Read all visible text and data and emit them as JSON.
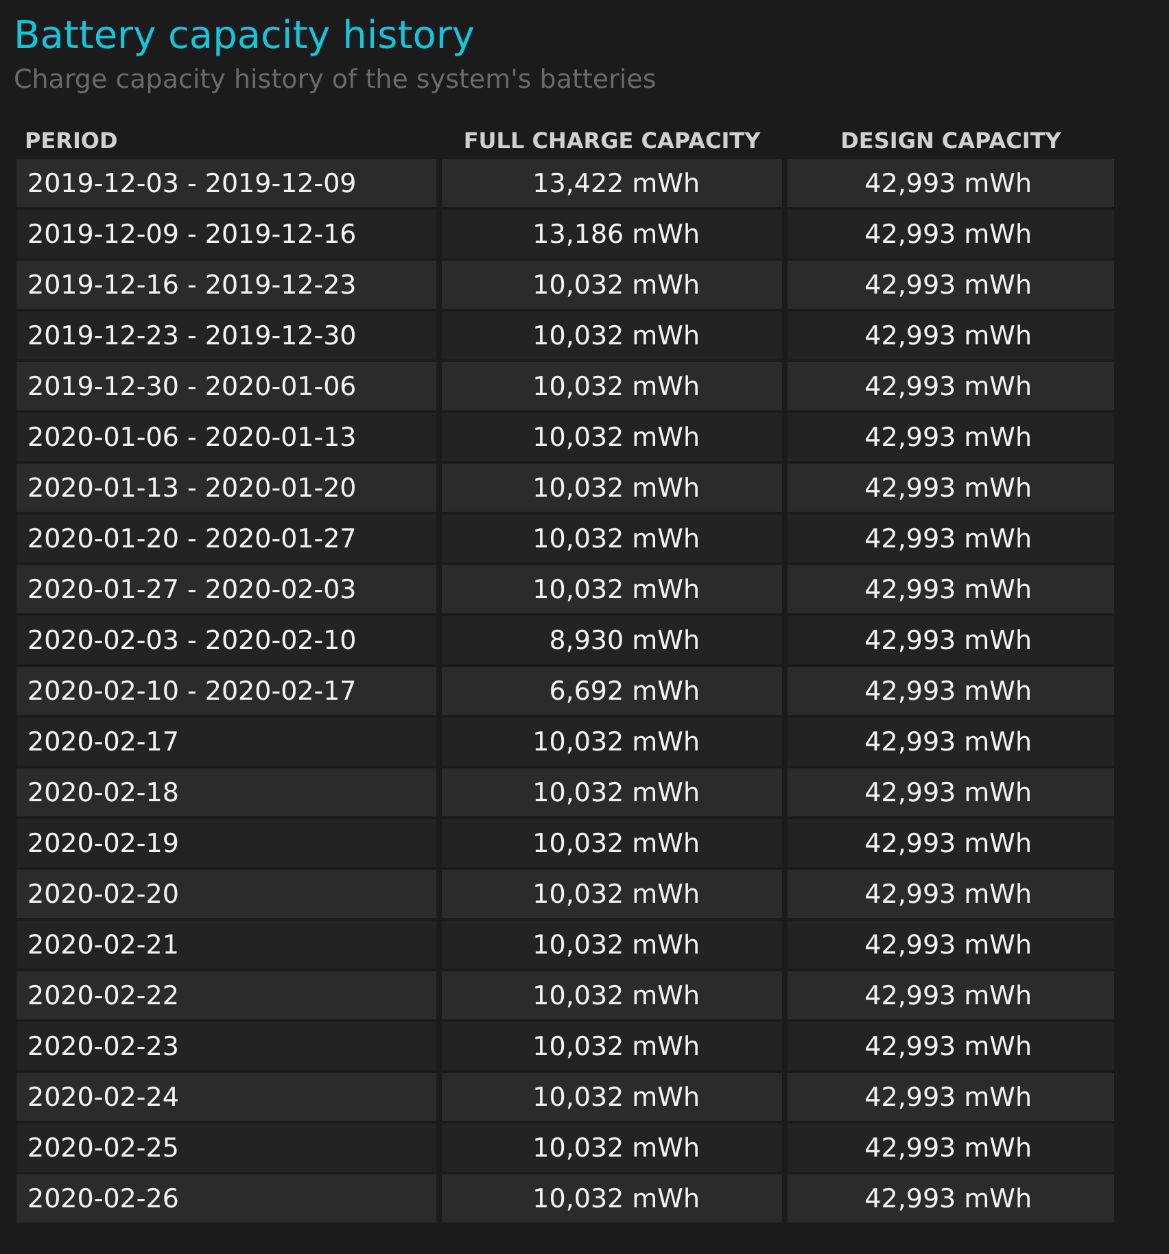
{
  "title": "Battery capacity history",
  "subtitle": "Charge capacity history of the system's batteries",
  "table": {
    "columns": [
      "PERIOD",
      "FULL CHARGE CAPACITY",
      "DESIGN CAPACITY"
    ],
    "rows": [
      [
        "2019-12-03 - 2019-12-09",
        "13,422 mWh",
        "42,993 mWh"
      ],
      [
        "2019-12-09 - 2019-12-16",
        "13,186 mWh",
        "42,993 mWh"
      ],
      [
        "2019-12-16 - 2019-12-23",
        "10,032 mWh",
        "42,993 mWh"
      ],
      [
        "2019-12-23 - 2019-12-30",
        "10,032 mWh",
        "42,993 mWh"
      ],
      [
        "2019-12-30 - 2020-01-06",
        "10,032 mWh",
        "42,993 mWh"
      ],
      [
        "2020-01-06 - 2020-01-13",
        "10,032 mWh",
        "42,993 mWh"
      ],
      [
        "2020-01-13 - 2020-01-20",
        "10,032 mWh",
        "42,993 mWh"
      ],
      [
        "2020-01-20 - 2020-01-27",
        "10,032 mWh",
        "42,993 mWh"
      ],
      [
        "2020-01-27 - 2020-02-03",
        "10,032 mWh",
        "42,993 mWh"
      ],
      [
        "2020-02-03 - 2020-02-10",
        "8,930 mWh",
        "42,993 mWh"
      ],
      [
        "2020-02-10 - 2020-02-17",
        "6,692 mWh",
        "42,993 mWh"
      ],
      [
        "2020-02-17",
        "10,032 mWh",
        "42,993 mWh"
      ],
      [
        "2020-02-18",
        "10,032 mWh",
        "42,993 mWh"
      ],
      [
        "2020-02-19",
        "10,032 mWh",
        "42,993 mWh"
      ],
      [
        "2020-02-20",
        "10,032 mWh",
        "42,993 mWh"
      ],
      [
        "2020-02-21",
        "10,032 mWh",
        "42,993 mWh"
      ],
      [
        "2020-02-22",
        "10,032 mWh",
        "42,993 mWh"
      ],
      [
        "2020-02-23",
        "10,032 mWh",
        "42,993 mWh"
      ],
      [
        "2020-02-24",
        "10,032 mWh",
        "42,993 mWh"
      ],
      [
        "2020-02-25",
        "10,032 mWh",
        "42,993 mWh"
      ],
      [
        "2020-02-26",
        "10,032 mWh",
        "42,993 mWh"
      ]
    ]
  }
}
